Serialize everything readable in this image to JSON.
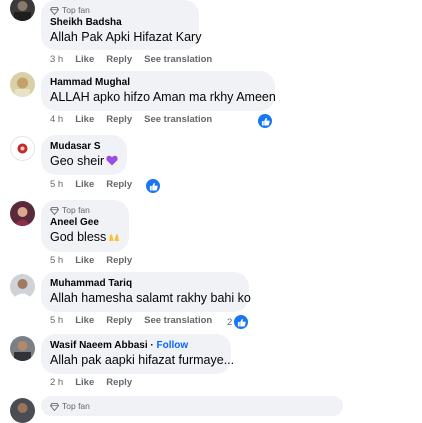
{
  "comments": [
    {
      "badge": "Top fan",
      "author": "Sheikh Badsha",
      "text": "Allah Pak Apki Hifazat Kary",
      "time": "3 h",
      "like": "Like",
      "reply": "Reply",
      "translate": "See translation"
    },
    {
      "author": "Hammad Mughal",
      "text": "ALLAH apko hifzo Aman ma rkhy Ameen",
      "time": "4 h",
      "like": "Like",
      "reply": "Reply",
      "translate": "See translation"
    },
    {
      "author": "Mudasar S",
      "text": "Geo sheir",
      "time": "5 h",
      "like": "Like",
      "reply": "Reply"
    },
    {
      "badge": "Top fan",
      "author": "Aneel Gee",
      "text": "God bless",
      "time": "5 h",
      "like": "Like",
      "reply": "Reply"
    },
    {
      "author": "Muhammad Tariq",
      "text": "Allah hamesha salamt rakhy bahi ko",
      "time": "5 h",
      "like": "Like",
      "reply": "Reply",
      "translate": "See translation",
      "reaction_count": "2"
    },
    {
      "author": "Wasif Naeem Abbasi",
      "separator": " · ",
      "follow": "Follow",
      "text": "Allah pak aapki hifazat furmaye...",
      "time": "2 h",
      "like": "Like",
      "reply": "Reply"
    },
    {
      "badge": "Top fan"
    }
  ],
  "colors": {
    "bubble": "#f0f2f5",
    "meta_text": "#65676b",
    "like_blue": "#1877f2",
    "follow_blue": "#0866ff"
  },
  "icons": [
    "diamond-top-fan-icon",
    "like-thumb-icon",
    "purple-heart-icon",
    "raising-hands-icon"
  ]
}
